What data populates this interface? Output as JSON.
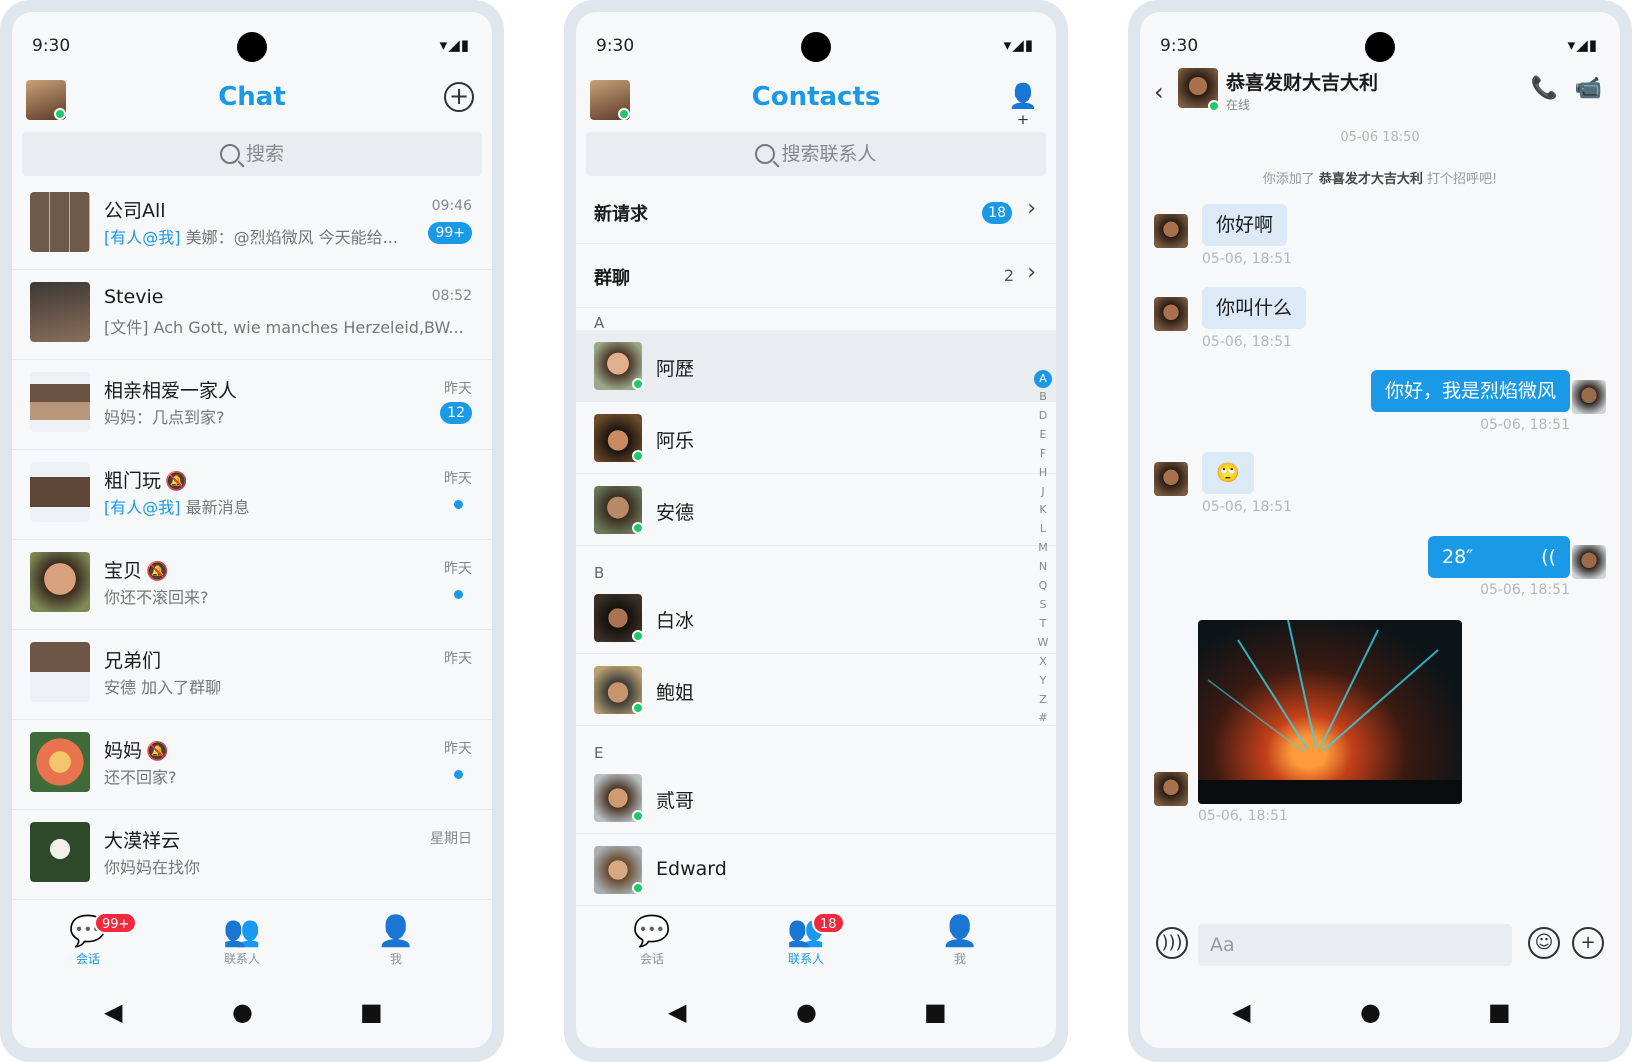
{
  "status": {
    "time": "9:30",
    "icons": "▾◢▮"
  },
  "chat": {
    "title": "Chat",
    "search_placeholder": "搜索",
    "items": [
      {
        "name": "公司All",
        "time": "09:46",
        "at": "[有人@我]",
        "msg": "美娜：@烈焰微风 今天能给...",
        "badge": "99+",
        "dot": false
      },
      {
        "name": "Stevie",
        "time": "08:52",
        "at": "",
        "msg": "[文件] Ach Gott, wie manches Herzeleid,BW...",
        "badge": "",
        "dot": false
      },
      {
        "name": "相亲相爱一家人",
        "time": "昨天",
        "at": "",
        "msg": "妈妈：几点到家?",
        "badge": "12",
        "dot": false
      },
      {
        "name": "粗门玩",
        "time": "昨天",
        "at": "[有人@我]",
        "msg": "最新消息",
        "badge": "",
        "dot": true,
        "muted": true
      },
      {
        "name": "宝贝",
        "time": "昨天",
        "at": "",
        "msg": "你还不滚回来?",
        "badge": "",
        "dot": true,
        "muted": true
      },
      {
        "name": "兄弟们",
        "time": "昨天",
        "at": "",
        "msg": "安德 加入了群聊",
        "badge": "",
        "dot": false
      },
      {
        "name": "妈妈",
        "time": "昨天",
        "at": "",
        "msg": "还不回家?",
        "badge": "",
        "dot": true,
        "muted": true
      },
      {
        "name": "大漠祥云",
        "time": "星期日",
        "at": "",
        "msg": "你妈妈在找你",
        "badge": "",
        "dot": false
      }
    ],
    "tabs": [
      {
        "label": "会话",
        "badge": "99+",
        "active": true
      },
      {
        "label": "联系人",
        "badge": "",
        "active": false
      },
      {
        "label": "我",
        "badge": "",
        "active": false
      }
    ]
  },
  "contacts": {
    "title": "Contacts",
    "search_placeholder": "搜索联系人",
    "new_requests_label": "新请求",
    "new_requests_count": "18",
    "group_label": "群聊",
    "group_count": "2",
    "sections": [
      {
        "letter": "A",
        "items": [
          "阿歷",
          "阿乐",
          "安德"
        ]
      },
      {
        "letter": "B",
        "items": [
          "白冰",
          "鲍姐"
        ]
      },
      {
        "letter": "E",
        "items": [
          "贰哥",
          "Edward"
        ]
      }
    ],
    "index": [
      "A",
      "B",
      "D",
      "E",
      "F",
      "H",
      "J",
      "K",
      "L",
      "M",
      "N",
      "Q",
      "S",
      "T",
      "W",
      "X",
      "Y",
      "Z",
      "#"
    ],
    "tabs": [
      {
        "label": "会话",
        "badge": "",
        "active": false
      },
      {
        "label": "联系人",
        "badge": "18",
        "active": true
      },
      {
        "label": "我",
        "badge": "",
        "active": false
      }
    ]
  },
  "conversation": {
    "name": "恭喜发财大吉大利",
    "status": "在线",
    "date_stamp": "05-06 18:50",
    "system_prefix": "你添加了",
    "system_name": "恭喜发才大吉大利",
    "system_suffix": "打个招呼吧!",
    "messages": [
      {
        "dir": "in",
        "text": "你好啊",
        "time": "05-06, 18:51"
      },
      {
        "dir": "in",
        "text": "你叫什么",
        "time": "05-06, 18:51"
      },
      {
        "dir": "out",
        "text": "你好，我是烈焰微风",
        "time": "05-06, 18:51"
      },
      {
        "dir": "in",
        "text": "🙄",
        "time": "05-06, 18:51"
      },
      {
        "dir": "out",
        "text": "28″",
        "time": "05-06, 18:51",
        "voice": true
      },
      {
        "dir": "in",
        "text": "",
        "time": "05-06, 18:51",
        "image": true
      }
    ],
    "input_placeholder": "Aa"
  },
  "nav": {
    "back": "◀",
    "home": "●",
    "recent": "■"
  },
  "colors": {
    "accent": "#1a99e6",
    "badge_red": "#f2283c",
    "online": "#1ec96b"
  }
}
